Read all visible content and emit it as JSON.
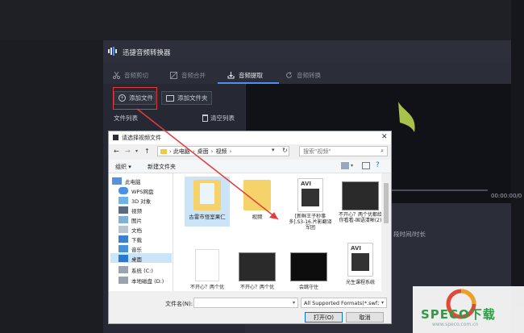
{
  "app": {
    "title": "迅捷音频转换器",
    "accent": "#4e8ef7",
    "tabs": [
      {
        "label": "音频剪切",
        "icon": "scissors-icon"
      },
      {
        "label": "音频合并",
        "icon": "merge-icon"
      },
      {
        "label": "音频提取",
        "icon": "extract-icon",
        "active": true
      },
      {
        "label": "音频转换",
        "icon": "refresh-icon"
      }
    ],
    "add_file_label": "添加文件",
    "add_folder_label": "添加文件夹",
    "file_list_label": "文件列表",
    "clear_list_label": "清空列表",
    "time_display": "00:00:00/0",
    "segment_label": "段时间/时长"
  },
  "dialog": {
    "title": "请选择视频文件",
    "breadcrumb": [
      "此电脑",
      "桌面",
      "视频"
    ],
    "search_placeholder": "搜索\"视频\"",
    "organize_label": "组织 ▾",
    "new_folder_label": "新建文件夹",
    "nav_items": [
      {
        "label": "此电脑",
        "icon": "computer-icon"
      },
      {
        "label": "WPS网盘",
        "icon": "cloud-icon"
      },
      {
        "label": "3D 对象",
        "icon": "cube-icon"
      },
      {
        "label": "视频",
        "icon": "video-icon"
      },
      {
        "label": "图片",
        "icon": "image-icon"
      },
      {
        "label": "文档",
        "icon": "document-icon"
      },
      {
        "label": "下载",
        "icon": "download-icon"
      },
      {
        "label": "音乐",
        "icon": "music-icon"
      },
      {
        "label": "桌面",
        "icon": "desktop-icon",
        "selected": true
      },
      {
        "label": "系统 (C:)",
        "icon": "drive-icon"
      },
      {
        "label": "本地磁盘 (D:)",
        "icon": "drive-icon"
      }
    ],
    "files": [
      {
        "name": "古雷市怪室果仁",
        "type": "folder"
      },
      {
        "name": "视频",
        "type": "folder"
      },
      {
        "name": "[新鲜王子秒事多].S3-16.片影翻译军团",
        "type": "avi"
      },
      {
        "name": "不开心？两个优都给你看看-国语清晰(2)",
        "type": "video"
      },
      {
        "name": "不开心？两个优",
        "type": "blank"
      },
      {
        "name": "不开心？两个优",
        "type": "video"
      },
      {
        "name": "会跳守住",
        "type": "video-dark"
      },
      {
        "name": "光生课程系统",
        "type": "avi"
      }
    ],
    "avi_badge": "AVI",
    "filename_label": "文件名(N):",
    "filename_value": "",
    "filter_value": "All Supported Formats(*.swf;",
    "open_label": "打开(O)",
    "cancel_label": "取消",
    "close_glyph": "✕"
  },
  "watermark": {
    "text": "SPECO下载",
    "subtext": "www.speco.com.cn"
  }
}
